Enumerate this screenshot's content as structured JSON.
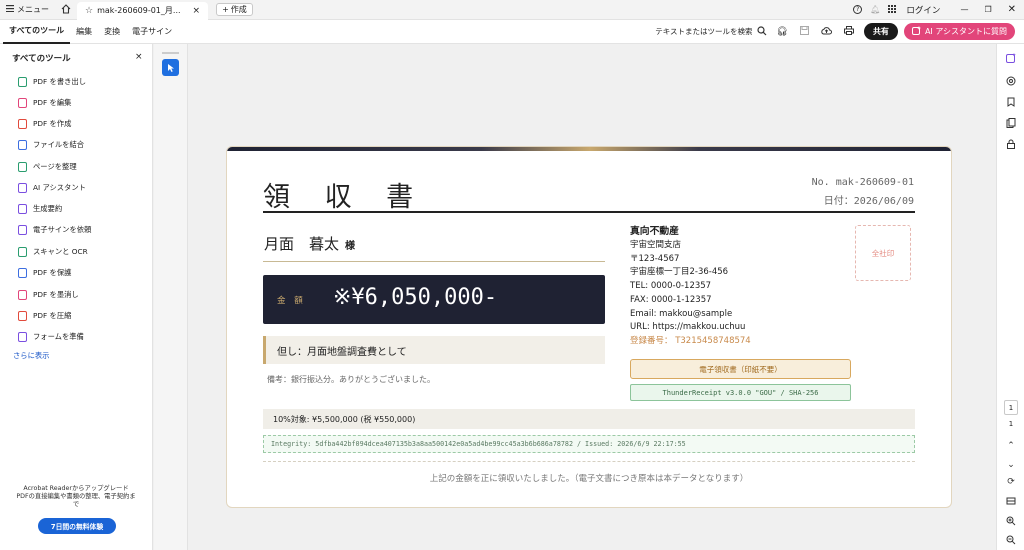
{
  "titlebar": {
    "menu_label": "メニュー",
    "tab_title": "mak-260609-01_月...",
    "new_tab_label": "作成",
    "login_label": "ログイン"
  },
  "menubar": {
    "tabs": [
      "すべてのツール",
      "編集",
      "変換",
      "電子サイン"
    ],
    "search_placeholder": "テキストまたはツールを検索",
    "share_label": "共有",
    "ai_label": "AI アシスタントに質問"
  },
  "left_panel": {
    "title": "すべてのツール",
    "tools": [
      {
        "label": "PDF を書き出し",
        "color": "#2a9d6f"
      },
      {
        "label": "PDF を編集",
        "color": "#e2457a"
      },
      {
        "label": "PDF を作成",
        "color": "#e14a3c"
      },
      {
        "label": "ファイルを結合",
        "color": "#3d6ee0"
      },
      {
        "label": "ページを整理",
        "color": "#2a9d6f"
      },
      {
        "label": "AI アシスタント",
        "color": "#7a4fe0"
      },
      {
        "label": "生成要約",
        "color": "#7a4fe0"
      },
      {
        "label": "電子サインを依頼",
        "color": "#7a4fe0"
      },
      {
        "label": "スキャンと OCR",
        "color": "#2a9d6f"
      },
      {
        "label": "PDF を保護",
        "color": "#3d6ee0"
      },
      {
        "label": "PDF を墨消し",
        "color": "#e2457a"
      },
      {
        "label": "PDF を圧縮",
        "color": "#e14a3c"
      },
      {
        "label": "フォームを準備",
        "color": "#7a4fe0"
      }
    ],
    "more_label": "さらに表示",
    "upgrade_text_1": "Acrobat Readerからアップグレード",
    "upgrade_text_2": "PDFの直接編集や書類の整理、電子契約ま",
    "upgrade_text_3": "で",
    "trial_label": "7日間の無料体験"
  },
  "receipt": {
    "title": "領 収 書",
    "number": "No. mak-260609-01",
    "date": "日付：2026/06/09",
    "customer": "月面　暮太",
    "honorific": "様",
    "amount_label": "金 額",
    "amount_value": "※¥6,050,000-",
    "tadashi": "但し：月面地盤調査費として",
    "bikou": "備考：銀行振込分。ありがとうございました。",
    "issuer": {
      "name": "真向不動産",
      "branch": "宇宙空間支店",
      "postal": "〒123-4567",
      "address": "宇宙座標一丁目2-36-456",
      "tel": "TEL: 0000-0-12357",
      "fax": "FAX: 0000-1-12357",
      "email": "Email: makkou@sample",
      "url": "URL: https://makkou.uchuu",
      "reg_no": "登録番号： T3215458748574"
    },
    "seal_label": "全社印",
    "e_receipt_badge": "電子領収書（印紙不要）",
    "generator_badge": "ThunderReceipt v3.0.0 \"GOU\" / SHA-256",
    "tax_line": "10%対象: ¥5,500,000 (税 ¥550,000)",
    "integrity": "Integrity: 5dfba442bf094dcea407135b3a8aa500142e0a5ad4be99cc45a3b6b686a78782 / Issued: 2026/6/9 22:17:55",
    "footer": "上記の金額を正に領収いたしました。（電子文書につき原本は本データとなります）"
  },
  "page_nav": {
    "current_page": "1",
    "total_pages": "1"
  }
}
